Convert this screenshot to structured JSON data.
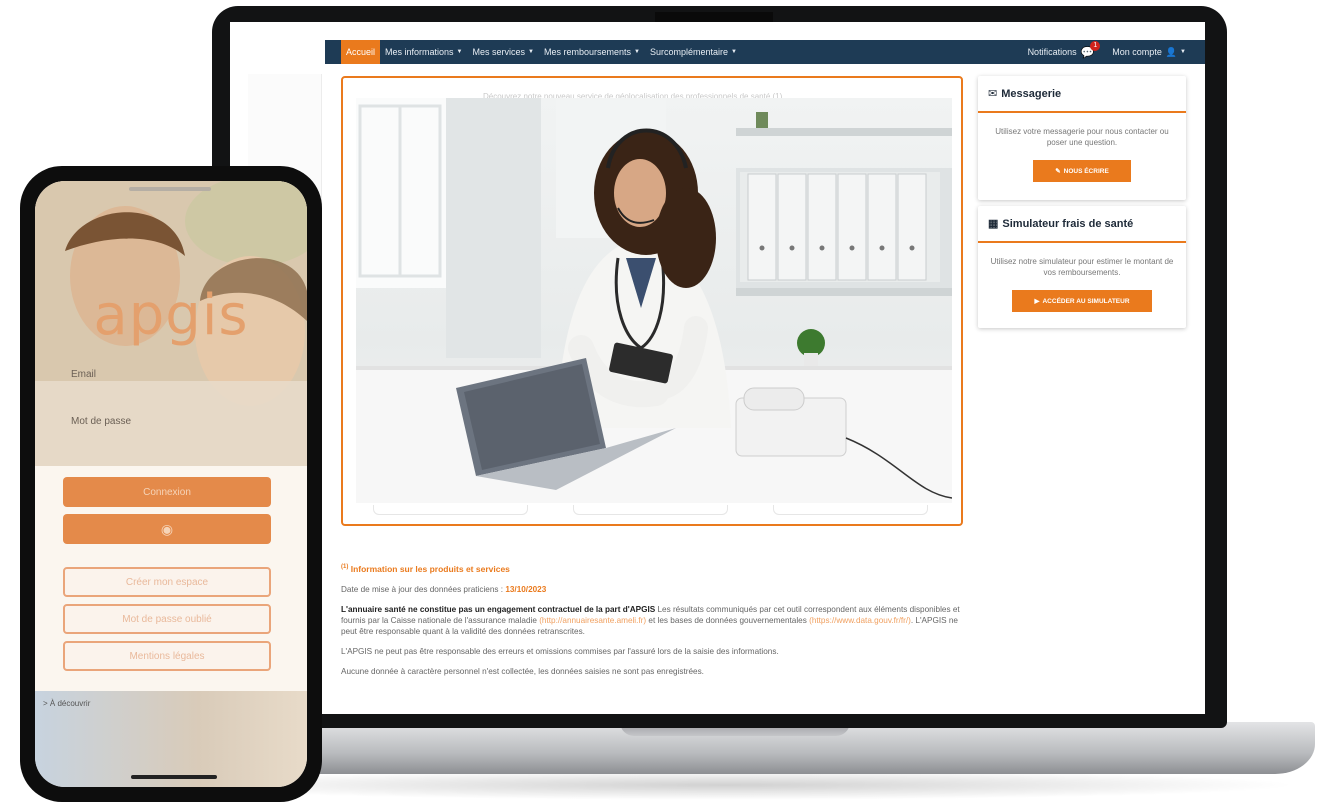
{
  "navbar": {
    "items": [
      {
        "label": "Accueil",
        "active": true,
        "dropdown": false
      },
      {
        "label": "Mes informations",
        "dropdown": true
      },
      {
        "label": "Mes services",
        "dropdown": true
      },
      {
        "label": "Mes remboursements",
        "dropdown": true
      },
      {
        "label": "Surcomplémentaire",
        "dropdown": true
      }
    ],
    "notifications_label": "Notifications",
    "notifications_count": "1",
    "account_label": "Mon compte"
  },
  "main": {
    "faded_text": "Découvrez notre nouveau service de géolocalisation des professionnels de santé (1)"
  },
  "footer": {
    "info_title": "Information sur les produits et services",
    "info_sup": "(1)",
    "update_prefix": "Date de mise à jour des données praticiens :",
    "update_date": "13/10/2023",
    "disclaimer_bold": "L'annuaire santé ne constitue pas un engagement contractuel de la part d'APGIS",
    "disclaimer_text_1": " Les résultats communiqués par cet outil correspondent aux éléments disponibles et fournis par la Caisse nationale de l'assurance maladie ",
    "link_ameli": "(http://annuairesante.ameli.fr)",
    "disclaimer_text_2": " et les bases de données gouvernementales ",
    "link_datagouv": "(https://www.data.gouv.fr/fr/)",
    "disclaimer_text_3": ". L'APGIS ne peut être responsable quant à la validité des données retranscrites.",
    "errors_text": "L'APGIS ne peut pas être responsable des erreurs et omissions commises par l'assuré lors de la saisie des informations.",
    "privacy_text": "Aucune donnée à caractère personnel n'est collectée, les données saisies ne sont pas enregistrées."
  },
  "messagerie": {
    "title": "Messagerie",
    "text": "Utilisez votre messagerie pour nous contacter ou poser une question.",
    "button": "NOUS ÉCRIRE"
  },
  "simulateur": {
    "title": "Simulateur frais de santé",
    "text": "Utilisez notre simulateur pour estimer le montant de vos remboursements.",
    "button": "ACCÉDER AU SIMULATEUR"
  },
  "phone": {
    "logo": "apgis",
    "email_label": "Email",
    "password_label": "Mot de passe",
    "connect_button": "Connexion",
    "first_login_button": "Créer mon espace",
    "forgot_password_button": "Mot de passe oublié",
    "help_button": "Mentions légales",
    "bottom_label": "> À découvrir"
  },
  "colors": {
    "accent": "#ea7a1d",
    "navbar": "#1e3b55"
  }
}
